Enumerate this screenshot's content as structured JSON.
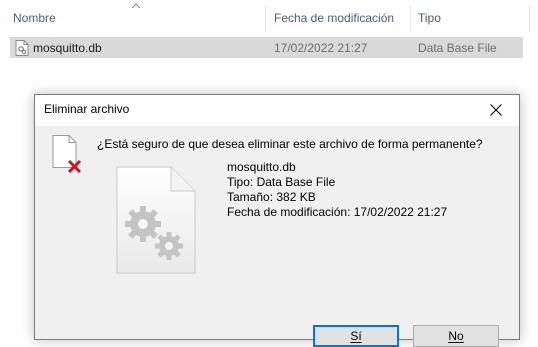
{
  "explorer": {
    "columns": {
      "name": "Nombre",
      "date": "Fecha de modificación",
      "type": "Tipo"
    },
    "rows": [
      {
        "name": "mosquitto.db",
        "date": "17/02/2022 21:27",
        "type": "Data Base File"
      }
    ]
  },
  "dialog": {
    "title": "Eliminar archivo",
    "question": "¿Está seguro de que desea eliminar este archivo de forma permanente?",
    "file": {
      "name": "mosquitto.db",
      "type_line": "Tipo: Data Base File",
      "size_line": "Tamaño: 382 KB",
      "date_line": "Fecha de modificación: 17/02/2022 21:27"
    },
    "yes_label": "Sí",
    "no_label": "No"
  },
  "colors": {
    "selection": "#d9d9d9",
    "header_text": "#4c607a",
    "dialog_bg": "#f0f0f0",
    "default_button_border": "#0078d7",
    "delete_mark": "#c8161d"
  },
  "icons": [
    "sort-up-icon",
    "file-icon",
    "delete-x-icon",
    "gear-file-icon",
    "close-icon"
  ]
}
